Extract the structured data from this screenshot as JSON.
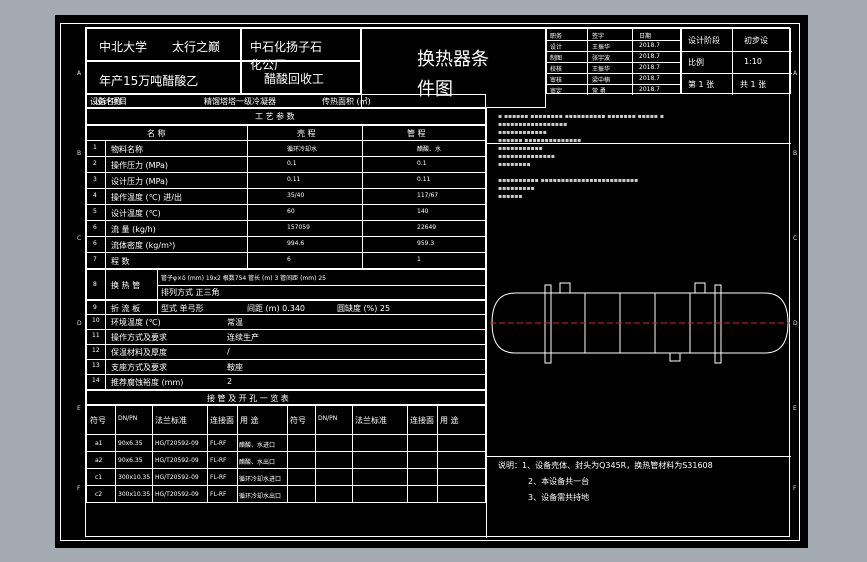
{
  "title_block": {
    "school": "中北大学",
    "author_line": "太行之巅",
    "company_line1": "中石化扬子石",
    "company_line2": "化公厂",
    "project_line": "年产15万吨醋酸乙",
    "project_line2": "醋酸回收工",
    "design_project": "设计项目",
    "drawing_name_1": "换热器条",
    "drawing_name_2": "件图",
    "stage_label": "设计阶段",
    "stage_value": "初步设",
    "scale_label": "比例",
    "scale_value": "1:10",
    "sheet_label": "第 1 张",
    "total_label": "共 1 张",
    "sig_rows": [
      {
        "role": "职务",
        "name": "签字",
        "date": "日期"
      },
      {
        "role": "设计",
        "name": "王振华",
        "date": "2018.7"
      },
      {
        "role": "制图",
        "name": "张宇波",
        "date": "2018.7"
      },
      {
        "role": "校核",
        "name": "王振华",
        "date": "2018.7"
      },
      {
        "role": "审核",
        "name": "梁中楠",
        "date": "2018.7"
      },
      {
        "role": "审定",
        "name": "常 勇",
        "date": "2018.7"
      }
    ]
  },
  "equipment_row": {
    "label": "设备名称",
    "value": "精馏塔塔一级冷凝器",
    "area_label": "传热面积 (㎡)"
  },
  "process_params": {
    "header": "工 艺 参 数",
    "col_name": "名 称",
    "col_shell": "壳 程",
    "col_tube": "管 程",
    "rows": [
      {
        "no": "1",
        "name": "物料名称",
        "shell": "循环冷却水",
        "tube": "醋酸、水"
      },
      {
        "no": "2",
        "name": "操作压力 (MPa)",
        "shell": "0.1",
        "tube": "0.1"
      },
      {
        "no": "3",
        "name": "设计压力 (MPa)",
        "shell": "0.11",
        "tube": "0.11"
      },
      {
        "no": "4",
        "name": "操作温度 (℃) 进/出",
        "shell": "35/40",
        "tube": "117/67"
      },
      {
        "no": "5",
        "name": "设计温度 (℃)",
        "shell": "60",
        "tube": "140"
      },
      {
        "no": "6",
        "name": "流 量 (kg/h)",
        "shell": "157059",
        "tube": "22649"
      },
      {
        "no": "6",
        "name": "流体密度 (kg/m³)",
        "shell": "994.6",
        "tube": "959.3"
      },
      {
        "no": "7",
        "name": "程 数",
        "shell": "6",
        "tube": "1"
      }
    ]
  },
  "tube_info": {
    "no": "8",
    "label": "换 热 管",
    "line1": "管子φ×δ (mm) 19x2  根数754  管长 (m) 3  管间距 (mm) 25",
    "line2": "排列方式  正三角"
  },
  "baffle": {
    "no": "9",
    "label": "折 流 板",
    "text": "型式 单弓形",
    "spacing": "间距 (m) 0.340",
    "cut": "圆缺度 (%)  25"
  },
  "misc_rows": [
    {
      "no": "10",
      "name": "环境温度 (℃)",
      "value": "常温"
    },
    {
      "no": "11",
      "name": "操作方式及要求",
      "value": "连续生产"
    },
    {
      "no": "12",
      "name": "保温材料及厚度",
      "value": "/"
    },
    {
      "no": "13",
      "name": "支座方式及要求",
      "value": "鞍座"
    },
    {
      "no": "14",
      "name": "推荐腐蚀裕度 (mm)",
      "value": "2"
    }
  ],
  "nozzle_table": {
    "header": "接 管 及 开 孔 一 览 表",
    "cols": [
      "符号",
      "DN/PN",
      "法兰标准",
      "连接面",
      "用 途",
      "符号",
      "DN/PN",
      "法兰标准",
      "连接面",
      "用 途"
    ],
    "rows": [
      {
        "sym": "a1",
        "dn": "90x6.35",
        "std": "HG/T20592-09",
        "face": "FL-RF",
        "use": "醋酸、水进口"
      },
      {
        "sym": "a2",
        "dn": "90x6.35",
        "std": "HG/T20592-09",
        "face": "FL-RF",
        "use": "醋酸、水出口"
      },
      {
        "sym": "c1",
        "dn": "300x10.35",
        "std": "HG/T20592-09",
        "face": "FL-RF",
        "use": "循环冷却水进口"
      },
      {
        "sym": "c2",
        "dn": "300x10.35",
        "std": "HG/T20592-09",
        "face": "FL-RF",
        "use": "循环冷却水出口"
      }
    ]
  },
  "notes": {
    "title": "说明",
    "items": [
      "说明：1、设备壳体、封头为Q345R，换热管材料为S31608",
      "2、本设备共一台",
      "3、设备需共持地"
    ]
  },
  "zone_letters_left": [
    "A",
    "B",
    "C",
    "D",
    "E",
    "F"
  ],
  "zone_letters_right": [
    "A",
    "B",
    "C",
    "D",
    "E",
    "F"
  ]
}
